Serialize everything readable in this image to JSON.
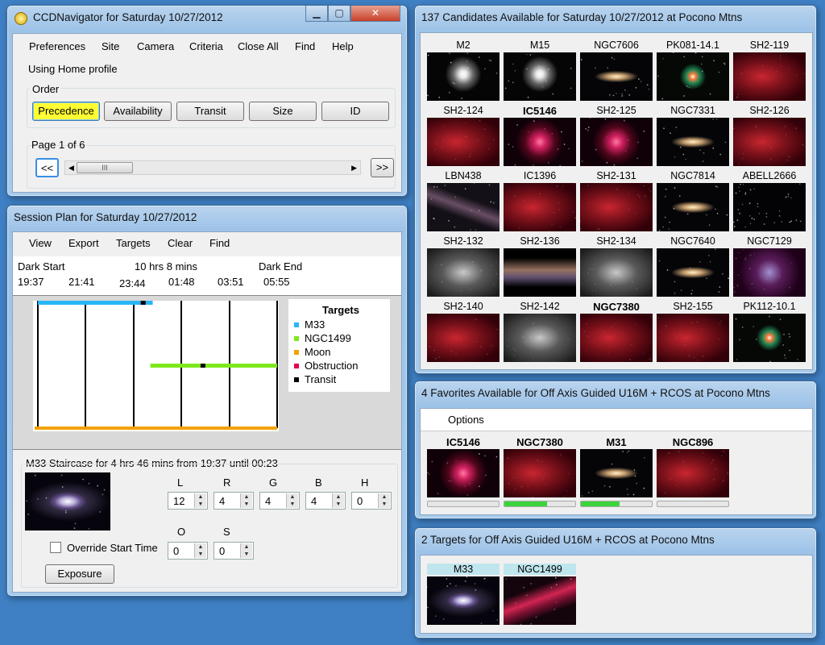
{
  "main_window": {
    "title": "CCDNavigator for Saturday 10/27/2012",
    "controls": {
      "minimize": "▁",
      "maximize": "▢",
      "close": "✕"
    },
    "menu": [
      "Preferences",
      "Site",
      "Camera",
      "Criteria",
      "Close All",
      "Find",
      "Help"
    ],
    "profile_text": "Using Home profile",
    "order": {
      "label": "Order",
      "buttons": [
        "Precedence",
        "Availability",
        "Transit",
        "Size",
        "ID"
      ],
      "selected": "Precedence"
    },
    "paging": {
      "page_text": "Page 1 of 6",
      "prev": "<<",
      "next": ">>",
      "scroll_thumb": "III"
    }
  },
  "session_plan": {
    "title": "Session Plan for Saturday 10/27/2012",
    "menu": [
      "View",
      "Export",
      "Targets",
      "Clear",
      "Find"
    ],
    "dark_start_label": "Dark Start",
    "duration_label": "10 hrs 8 mins",
    "dark_end_label": "Dark End",
    "times": [
      "19:37",
      "21:41",
      "23:44",
      "01:48",
      "03:51",
      "05:55"
    ],
    "legend": {
      "title": "Targets",
      "items": [
        {
          "label": "M33",
          "color": "#29b6f6"
        },
        {
          "label": "NGC1499",
          "color": "#7ee81e"
        },
        {
          "label": "Moon",
          "color": "#f2a100"
        },
        {
          "label": "Obstruction",
          "color": "#e0004d"
        },
        {
          "label": "Transit",
          "color": "#000000"
        }
      ]
    },
    "timeline": {
      "m33": {
        "start": 0.0,
        "end": 0.48,
        "transit": 0.44
      },
      "ngc1499": {
        "start": 0.47,
        "end": 1.0,
        "transit": 0.69
      },
      "moon": {
        "start": 0.0,
        "end": 1.0
      }
    },
    "exposure": {
      "header": "M33  Staircase for 4 hrs 46 mins from 19:37 until 00:23",
      "filters": [
        {
          "label": "L",
          "value": "12"
        },
        {
          "label": "R",
          "value": "4"
        },
        {
          "label": "G",
          "value": "4"
        },
        {
          "label": "B",
          "value": "4"
        },
        {
          "label": "H",
          "value": "0"
        },
        {
          "label": "O",
          "value": "0"
        },
        {
          "label": "S",
          "value": "0"
        }
      ],
      "override_label": "Override Start Time",
      "button_label": "Exposure"
    }
  },
  "candidates": {
    "title": "137 Candidates Available for Saturday 10/27/2012 at Pocono Mtns",
    "items": [
      {
        "name": "M2",
        "bold": false,
        "type": "globular"
      },
      {
        "name": "M15",
        "bold": false,
        "type": "globular"
      },
      {
        "name": "NGC7606",
        "bold": false,
        "type": "galaxy"
      },
      {
        "name": "PK081-14.1",
        "bold": false,
        "type": "planetary"
      },
      {
        "name": "SH2-119",
        "bold": false,
        "type": "nebula"
      },
      {
        "name": "SH2-124",
        "bold": false,
        "type": "nebula"
      },
      {
        "name": "IC5146",
        "bold": true,
        "type": "cocoon"
      },
      {
        "name": "SH2-125",
        "bold": false,
        "type": "cocoon"
      },
      {
        "name": "NGC7331",
        "bold": false,
        "type": "galaxy"
      },
      {
        "name": "SH2-126",
        "bold": false,
        "type": "nebula"
      },
      {
        "name": "LBN438",
        "bold": false,
        "type": "dust"
      },
      {
        "name": "IC1396",
        "bold": false,
        "type": "nebula"
      },
      {
        "name": "SH2-131",
        "bold": false,
        "type": "nebula"
      },
      {
        "name": "NGC7814",
        "bold": false,
        "type": "galaxy"
      },
      {
        "name": "ABELL2666",
        "bold": false,
        "type": "stars"
      },
      {
        "name": "SH2-132",
        "bold": false,
        "type": "mono"
      },
      {
        "name": "SH2-136",
        "bold": false,
        "type": "band"
      },
      {
        "name": "SH2-134",
        "bold": false,
        "type": "mono"
      },
      {
        "name": "NGC7640",
        "bold": false,
        "type": "galaxy"
      },
      {
        "name": "NGC7129",
        "bold": false,
        "type": "reflection"
      },
      {
        "name": "SH2-140",
        "bold": false,
        "type": "nebula"
      },
      {
        "name": "SH2-142",
        "bold": false,
        "type": "mono"
      },
      {
        "name": "NGC7380",
        "bold": true,
        "type": "nebula"
      },
      {
        "name": "SH2-155",
        "bold": false,
        "type": "nebula"
      },
      {
        "name": "PK112-10.1",
        "bold": false,
        "type": "planetary"
      }
    ]
  },
  "favorites": {
    "title": "4 Favorites Available for Off Axis Guided U16M + RCOS at Pocono Mtns",
    "menu": [
      "Options"
    ],
    "items": [
      {
        "name": "IC5146",
        "type": "cocoon",
        "progress": 0.0
      },
      {
        "name": "NGC7380",
        "type": "nebula",
        "progress": 0.6
      },
      {
        "name": "M31",
        "type": "galaxy",
        "progress": 0.55
      },
      {
        "name": "NGC896",
        "type": "nebula",
        "progress": 0.0
      }
    ]
  },
  "targets": {
    "title": "2 Targets for Off Axis Guided U16M + RCOS at Pocono Mtns",
    "items": [
      {
        "name": "M33",
        "type": "spiral"
      },
      {
        "name": "NGC1499",
        "type": "california"
      }
    ]
  }
}
